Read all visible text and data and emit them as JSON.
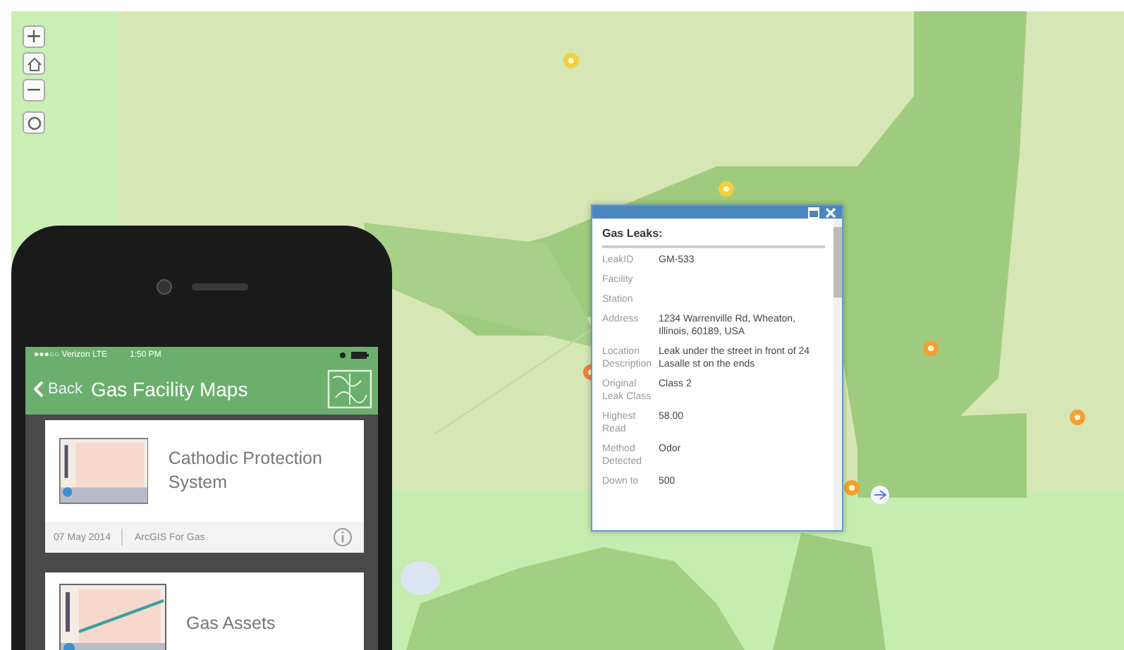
{
  "map": {
    "zoom_in": "+",
    "zoom_out": "−"
  },
  "popup": {
    "title": "Gas Leaks:",
    "fields": [
      {
        "label": "LeakID",
        "value": "GM-533"
      },
      {
        "label": "Facility"
      },
      {
        "label": "Station"
      },
      {
        "label": "Address",
        "value": "1234 Warrenville Rd, Wheaton, Illinois, 60189, USA"
      },
      {
        "label": "Location Description",
        "value": "Leak under the street in front of 24 Lasalle st on the ends"
      },
      {
        "label": "Original Leak Class",
        "value": "Class 2"
      },
      {
        "label": "Highest Read",
        "value": "58.00"
      },
      {
        "label": "Method Detected",
        "value": "Odor"
      },
      {
        "label": "Down to",
        "value": "500"
      }
    ]
  },
  "phone": {
    "carrier": "●●●○○ Verizon  LTE",
    "time": "1:50 PM",
    "back": "Back",
    "title": "Gas Facility Maps",
    "cards": [
      {
        "title": "Cathodic Protection System",
        "date": "07 May 2014",
        "owner": "ArcGIS For Gas"
      },
      {
        "title": "Gas Assets"
      }
    ]
  }
}
